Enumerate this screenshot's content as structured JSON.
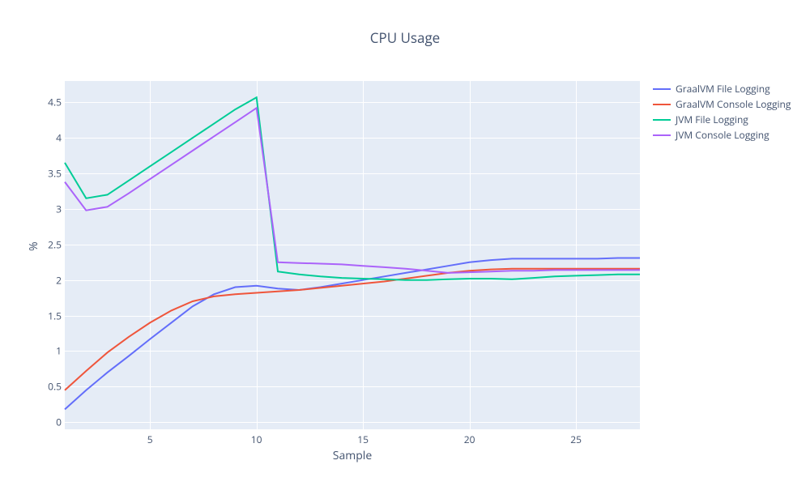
{
  "chart_data": {
    "type": "line",
    "title": "CPU Usage",
    "xlabel": "Sample",
    "ylabel": "%",
    "xlim": [
      1,
      28
    ],
    "ylim": [
      -0.1,
      4.8
    ],
    "xticks": [
      5,
      10,
      15,
      20,
      25
    ],
    "yticks": [
      0,
      0.5,
      1,
      1.5,
      2,
      2.5,
      3,
      3.5,
      4,
      4.5
    ],
    "x": [
      1,
      2,
      3,
      4,
      5,
      6,
      7,
      8,
      9,
      10,
      11,
      12,
      13,
      14,
      15,
      16,
      17,
      18,
      19,
      20,
      21,
      22,
      23,
      24,
      25,
      26,
      27,
      28
    ],
    "series": [
      {
        "name": "GraalVM File Logging",
        "color": "#636efa",
        "values": [
          0.18,
          0.45,
          0.7,
          0.93,
          1.17,
          1.4,
          1.63,
          1.8,
          1.9,
          1.92,
          1.88,
          1.86,
          1.9,
          1.95,
          2.0,
          2.05,
          2.1,
          2.15,
          2.2,
          2.25,
          2.28,
          2.3,
          2.3,
          2.3,
          2.3,
          2.3,
          2.31,
          2.31
        ]
      },
      {
        "name": "GraalVM Console Logging",
        "color": "#ef553b",
        "values": [
          0.45,
          0.72,
          0.98,
          1.2,
          1.4,
          1.57,
          1.7,
          1.77,
          1.8,
          1.82,
          1.84,
          1.86,
          1.89,
          1.92,
          1.95,
          1.98,
          2.02,
          2.06,
          2.1,
          2.13,
          2.15,
          2.16,
          2.16,
          2.16,
          2.16,
          2.16,
          2.16,
          2.16
        ]
      },
      {
        "name": "JVM File Logging",
        "color": "#00cc96",
        "values": [
          3.65,
          3.15,
          3.2,
          3.4,
          3.6,
          3.8,
          4.0,
          4.2,
          4.4,
          4.57,
          2.12,
          2.08,
          2.05,
          2.03,
          2.02,
          2.01,
          2.0,
          2.0,
          2.01,
          2.02,
          2.02,
          2.01,
          2.03,
          2.05,
          2.06,
          2.07,
          2.08,
          2.08
        ]
      },
      {
        "name": "JVM Console Logging",
        "color": "#ab63fa",
        "values": [
          3.38,
          2.98,
          3.03,
          3.22,
          3.42,
          3.62,
          3.82,
          4.02,
          4.22,
          4.42,
          2.25,
          2.24,
          2.23,
          2.22,
          2.2,
          2.18,
          2.16,
          2.13,
          2.1,
          2.11,
          2.12,
          2.13,
          2.13,
          2.14,
          2.14,
          2.14,
          2.14,
          2.14
        ]
      }
    ]
  }
}
